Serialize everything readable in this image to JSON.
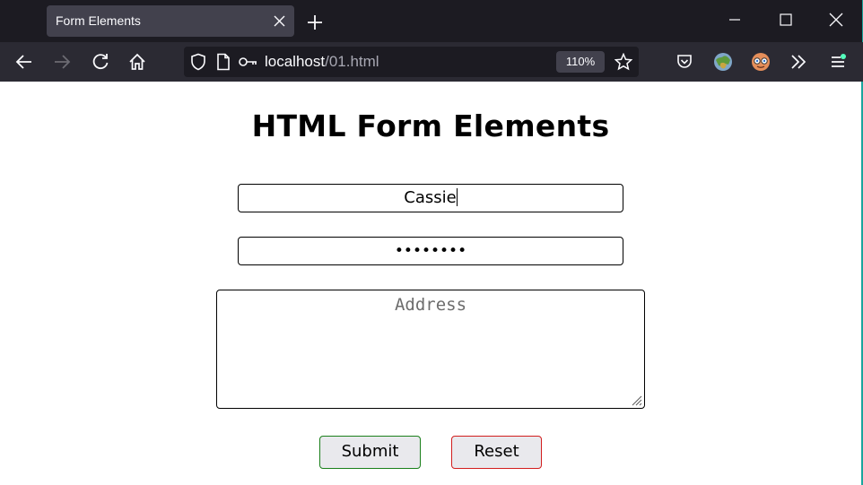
{
  "browser": {
    "tab_title": "Form Elements",
    "url_host": "localhost",
    "url_path": "/01.html",
    "zoom": "110%",
    "accent": "#1aa59d"
  },
  "page": {
    "heading": "HTML Form Elements",
    "name_value": "Cassie",
    "password_mask": "••••••••",
    "address_placeholder": "Address",
    "submit_label": "Submit",
    "reset_label": "Reset",
    "submit_border": "#1a7f1a",
    "reset_border": "#d21e1e"
  }
}
